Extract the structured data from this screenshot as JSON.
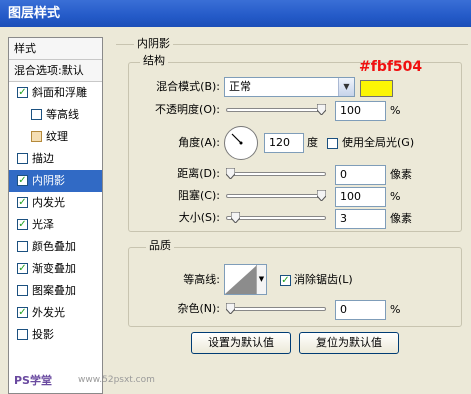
{
  "window": {
    "title": "图层样式"
  },
  "sidebar": {
    "header_styles": "样式",
    "header_blend": "混合选项:默认",
    "items": [
      {
        "label": "斜面和浮雕",
        "checked": true
      },
      {
        "label": "等高线",
        "checked": false
      },
      {
        "label": "纹理",
        "checked": false
      },
      {
        "label": "描边",
        "checked": false
      },
      {
        "label": "内阴影",
        "checked": true,
        "selected": true
      },
      {
        "label": "内发光",
        "checked": true
      },
      {
        "label": "光泽",
        "checked": true
      },
      {
        "label": "颜色叠加",
        "checked": false
      },
      {
        "label": "渐变叠加",
        "checked": true
      },
      {
        "label": "图案叠加",
        "checked": false
      },
      {
        "label": "外发光",
        "checked": true
      },
      {
        "label": "投影",
        "checked": false
      }
    ]
  },
  "panel": {
    "title": "内阴影",
    "structure": {
      "title": "结构",
      "blend_mode_label": "混合模式(B):",
      "blend_mode_value": "正常",
      "color_hex": "#fbf504",
      "color_annotation": "#fbf504",
      "opacity_label": "不透明度(O):",
      "opacity_value": "100",
      "angle_label": "角度(A):",
      "angle_value": "120",
      "angle_unit": "度",
      "global_light_label": "使用全局光(G)",
      "global_light_checked": false,
      "distance_label": "距离(D):",
      "distance_value": "0",
      "choke_label": "阻塞(C):",
      "choke_value": "100",
      "size_label": "大小(S):",
      "size_value": "3",
      "unit_px": "像素",
      "unit_pct": "%",
      "slider_levels": {
        "opacity": 1.0,
        "distance": 0.0,
        "choke": 1.0,
        "size": 0.05
      }
    },
    "quality": {
      "title": "品质",
      "contour_label": "等高线:",
      "antialias_label": "消除锯齿(L)",
      "antialias_checked": true,
      "noise_label": "杂色(N):",
      "noise_value": "0",
      "noise_unit": "%",
      "noise_level": 0.0
    },
    "buttons": {
      "make_default": "设置为默认值",
      "reset_default": "复位为默认值"
    }
  },
  "watermark": {
    "left": "PS学堂",
    "right": "www.52psxt.com"
  }
}
